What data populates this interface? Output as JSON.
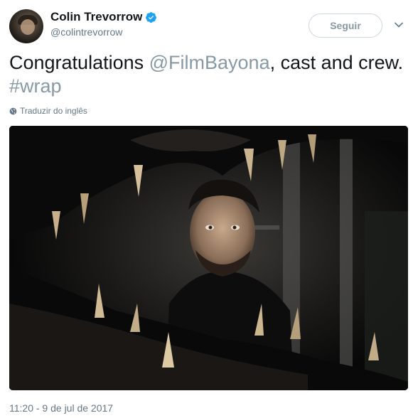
{
  "author": {
    "name": "Colin Trevorrow",
    "handle": "@colintrevorrow",
    "verified_icon": "verified-badge-icon"
  },
  "actions": {
    "follow_label": "Seguir",
    "more_icon": "chevron-down-icon"
  },
  "tweet": {
    "text_before": "Congratulations ",
    "mention": "@FilmBayona",
    "text_middle": ", cast and crew. ",
    "hashtag": "#wrap",
    "translate_label": "Traduzir do inglês",
    "translate_icon": "globe-icon",
    "timestamp": "11:20 - 9 de jul de 2017"
  },
  "colors": {
    "link": "#8899a6",
    "verified": "#1da1f2",
    "secondary_text": "#657786"
  }
}
